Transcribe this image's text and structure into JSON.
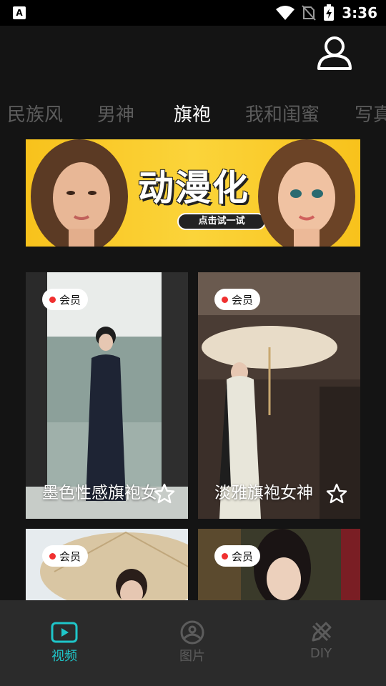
{
  "status_bar": {
    "time": "3:36"
  },
  "header": {
    "user_icon": "user-profile-icon"
  },
  "tabs": [
    {
      "label": "民族风",
      "active": false
    },
    {
      "label": "男神",
      "active": false
    },
    {
      "label": "旗袍",
      "active": true
    },
    {
      "label": "我和闺蜜",
      "active": false
    },
    {
      "label": "写真",
      "active": false
    }
  ],
  "banner": {
    "title": "动漫化",
    "button": "点击试一试"
  },
  "cards": [
    {
      "badge": "会员",
      "title": "墨色性感旗袍女"
    },
    {
      "badge": "会员",
      "title": "淡雅旗袍女神"
    },
    {
      "badge": "会员",
      "title": ""
    },
    {
      "badge": "会员",
      "title": ""
    }
  ],
  "bottom_nav": [
    {
      "label": "视频",
      "icon": "video-icon",
      "active": true
    },
    {
      "label": "图片",
      "icon": "image-icon",
      "active": false
    },
    {
      "label": "DIY",
      "icon": "diy-pencil-icon",
      "active": false
    }
  ],
  "colors": {
    "accent": "#1fc6c9",
    "inactive": "#5c5c5c",
    "badge_dot": "#f03030",
    "banner_yellow": "#fbd43a"
  }
}
